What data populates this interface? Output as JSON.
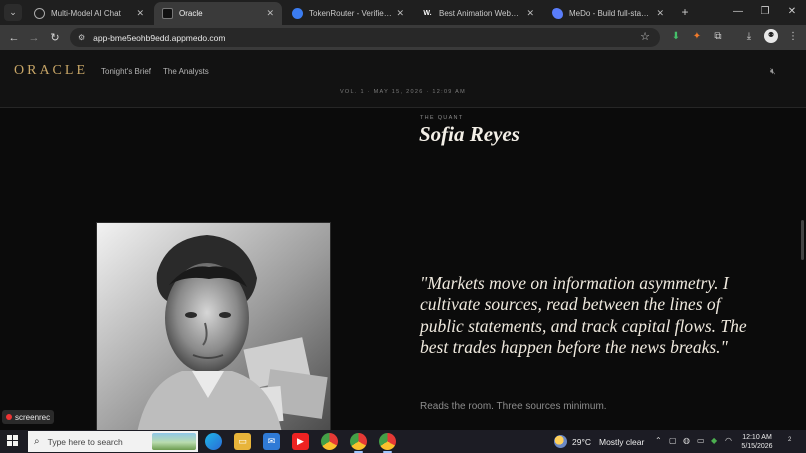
{
  "browser": {
    "tabs": [
      {
        "title": "Multi-Model AI Chat",
        "icon": "chat-icon",
        "active": false
      },
      {
        "title": "Oracle",
        "icon": "oracle-favicon",
        "active": true
      },
      {
        "title": "TokenRouter - Verified Mode",
        "icon": "toggle-icon",
        "active": false
      },
      {
        "title": "Best Animation Websites | W",
        "icon": "w-icon",
        "active": false
      },
      {
        "title": "MeDo - Build full-stack App",
        "icon": "medo-icon",
        "active": false
      }
    ],
    "url": "app-bme5eohb9edd.appmedo.com"
  },
  "site": {
    "brand": "ORACLE",
    "nav": [
      "Tonight's Brief",
      "The Analysts"
    ],
    "issue_line": "VOL. 1 · MAY 15, 2026 · 12:09 AM"
  },
  "analyst": {
    "role": "THE QUANT",
    "name": "Sofia Reyes",
    "quote": "\"Markets move on information asymmetry. I cultivate sources, read between the lines of public statements, and track capital flows. The best trades happen before the news breaks.\"",
    "tagline": "Reads the room. Three sources minimum."
  },
  "overlay": {
    "recorder_label": "screenrec"
  },
  "taskbar": {
    "search_placeholder": "Type here to search",
    "weather_temp": "29°C",
    "weather_text": "Mostly clear",
    "time": "12:10 AM",
    "date": "5/15/2026",
    "notification_count": "2"
  },
  "colors": {
    "brand_gold": "#c8a667",
    "page_bg": "#0b0b0b",
    "quote_text": "#efe9de"
  }
}
